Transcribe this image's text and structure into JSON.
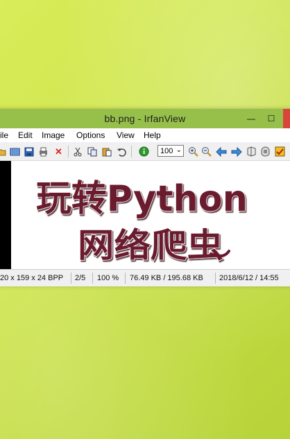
{
  "window": {
    "title": "bb.png - IrfanView",
    "min_glyph": "—",
    "max_glyph": "☐"
  },
  "menu": [
    "ile",
    "Edit",
    "Image",
    "Options",
    "View",
    "Help"
  ],
  "toolbar": {
    "zoom_value": "100",
    "icons": [
      "open-icon",
      "thumbnails-icon",
      "save-icon",
      "print-icon",
      "delete-icon",
      "cut-icon",
      "copy-icon",
      "paste-icon",
      "undo-icon",
      "info-icon",
      "zoom-in-icon",
      "zoom-out-icon",
      "previous-icon",
      "next-icon",
      "slideshow-icon",
      "settings-icon",
      "checkbox-icon"
    ]
  },
  "image_text": {
    "line1": "玩转Python",
    "line2": "网络爬虫"
  },
  "status": {
    "dimensions": "20 x 159 x 24 BPP",
    "index": "2/5",
    "zoom": "100 %",
    "size": "76.49 KB / 195.68 KB",
    "datetime": "2018/6/12 / 14:55"
  },
  "colors": {
    "desktop_accent": "#cfe64a",
    "titlebar": "#97c04a",
    "art_text": "#6b1a2e"
  }
}
